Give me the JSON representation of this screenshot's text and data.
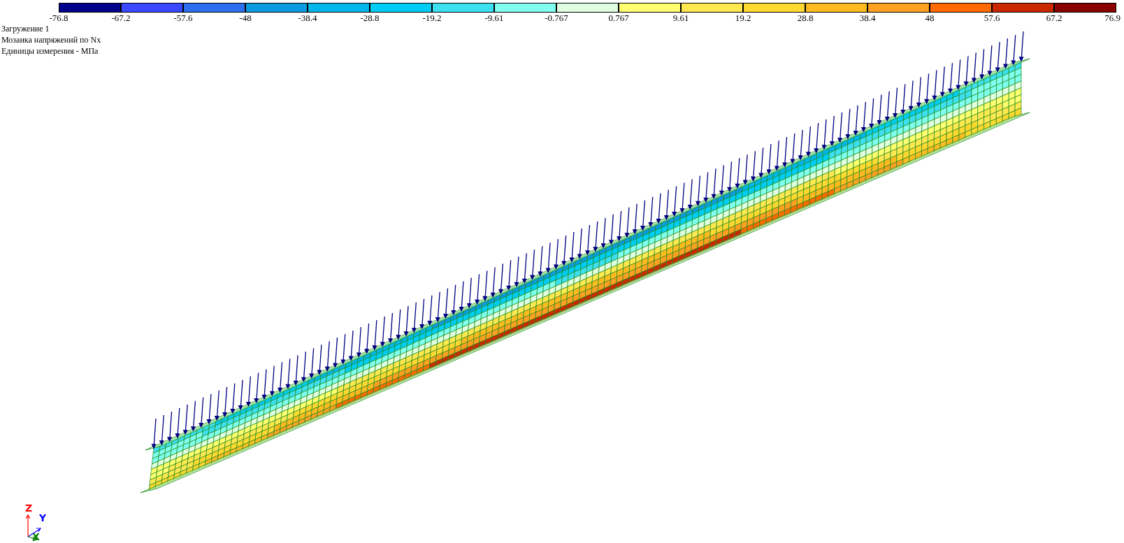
{
  "legend": {
    "cells": [
      {
        "color": "#00008b"
      },
      {
        "color": "#3a48ff"
      },
      {
        "color": "#2e6ff0"
      },
      {
        "color": "#0a9be0"
      },
      {
        "color": "#00b6ea"
      },
      {
        "color": "#00cdf5"
      },
      {
        "color": "#3ce0f0"
      },
      {
        "color": "#80fff0"
      },
      {
        "color": "#e0ffe0"
      },
      {
        "color": "#ffff70"
      },
      {
        "color": "#ffe850"
      },
      {
        "color": "#ffd830"
      },
      {
        "color": "#ffbb20"
      },
      {
        "color": "#ffa020"
      },
      {
        "color": "#ff6a00"
      },
      {
        "color": "#cc2800"
      },
      {
        "color": "#880000"
      }
    ],
    "labels": [
      "-76.8",
      "-67.2",
      "-57.6",
      "-48",
      "-38.4",
      "-28.8",
      "-19.2",
      "-9.61",
      "-0.767",
      "0.767",
      "9.61",
      "19.2",
      "28.8",
      "38.4",
      "48",
      "57.6",
      "67.2",
      "76.9"
    ]
  },
  "info_lines": [
    "Загружение 1",
    "Мозаика напряжений по Nx",
    "Единицы измерения - МПа"
  ],
  "axes": {
    "z_label": "Z",
    "y_label": "Y",
    "x_label": "X"
  }
}
